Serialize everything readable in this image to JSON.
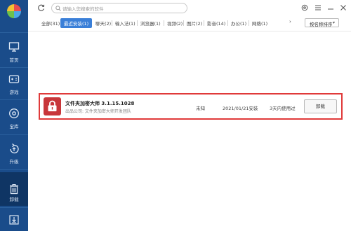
{
  "sidebar": {
    "items": [
      {
        "label": "首页",
        "icon": "monitor-icon"
      },
      {
        "label": "游戏",
        "icon": "gamepad-icon"
      },
      {
        "label": "宝库",
        "icon": "treasury-icon"
      },
      {
        "label": "升级",
        "icon": "upgrade-icon"
      },
      {
        "label": "卸载",
        "icon": "trash-icon",
        "active": true
      }
    ],
    "bottom_icon": "download-icon"
  },
  "header": {
    "search_placeholder": "请输入您搜索的软件"
  },
  "tabs": {
    "items": [
      {
        "label": "全部(31)"
      },
      {
        "label": "最近安装(1)",
        "active": true
      },
      {
        "label": "聊天(2)"
      },
      {
        "label": "输入法(1)"
      },
      {
        "label": "浏览器(1)"
      },
      {
        "label": "视频(2)"
      },
      {
        "label": "图片(2)"
      },
      {
        "label": "影音(14)"
      },
      {
        "label": "办公(1)"
      },
      {
        "label": "网络(1)"
      }
    ],
    "more_arrow": "›",
    "sort_label": "按名称排序",
    "sort_caret": "▾"
  },
  "software_list": [
    {
      "name": "文件夹加密大师 3.1.15.1028",
      "publisher": "出品公司: 文件夹加密大师开发团队",
      "size": "未知",
      "install_date": "2021/01/21安装",
      "usage": "3天内使用过",
      "action_label": "卸载"
    }
  ],
  "colors": {
    "sidebar": "#1a4c8a",
    "active_tab": "#3a7fd8",
    "highlight_border": "#e03a3a",
    "app_icon": "#c8363a"
  }
}
